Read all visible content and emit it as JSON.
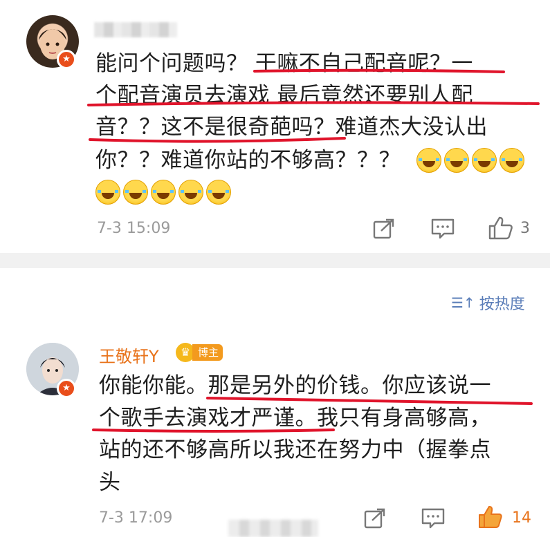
{
  "comments": [
    {
      "avatar": "user-avatar-girl",
      "verified_icon": "verified-badge-icon",
      "lines": [
        "能问个问题吗？ 干嘛不自己配音呢？一",
        "个配音演员去演戏 最后竟然还要别人配",
        "音？？这不是很奇葩吗？难道杰大没认出",
        "你？？难道你站的不够高？？？"
      ],
      "emoji_name": "laughing-crying-emoji",
      "timestamp": "7-3 15:09",
      "like_count": "3"
    },
    {
      "avatar": "user-avatar-boy",
      "username": "王敬轩Y",
      "badge": "博主",
      "lines": [
        "你能你能。那是另外的价钱。你应该说一",
        "个歌手去演戏才严谨。我只有身高够高，",
        "站的还不够高所以我还在努力中（握拳点",
        "头"
      ],
      "timestamp": "7-3 17:09",
      "like_count": "14"
    }
  ],
  "sort_label": "按热度",
  "colors": {
    "username": "#e8731b",
    "underline": "#e0142b",
    "link": "#5a7db8",
    "timestamp": "#9a9a9a",
    "separator": "#f1f1f1"
  }
}
